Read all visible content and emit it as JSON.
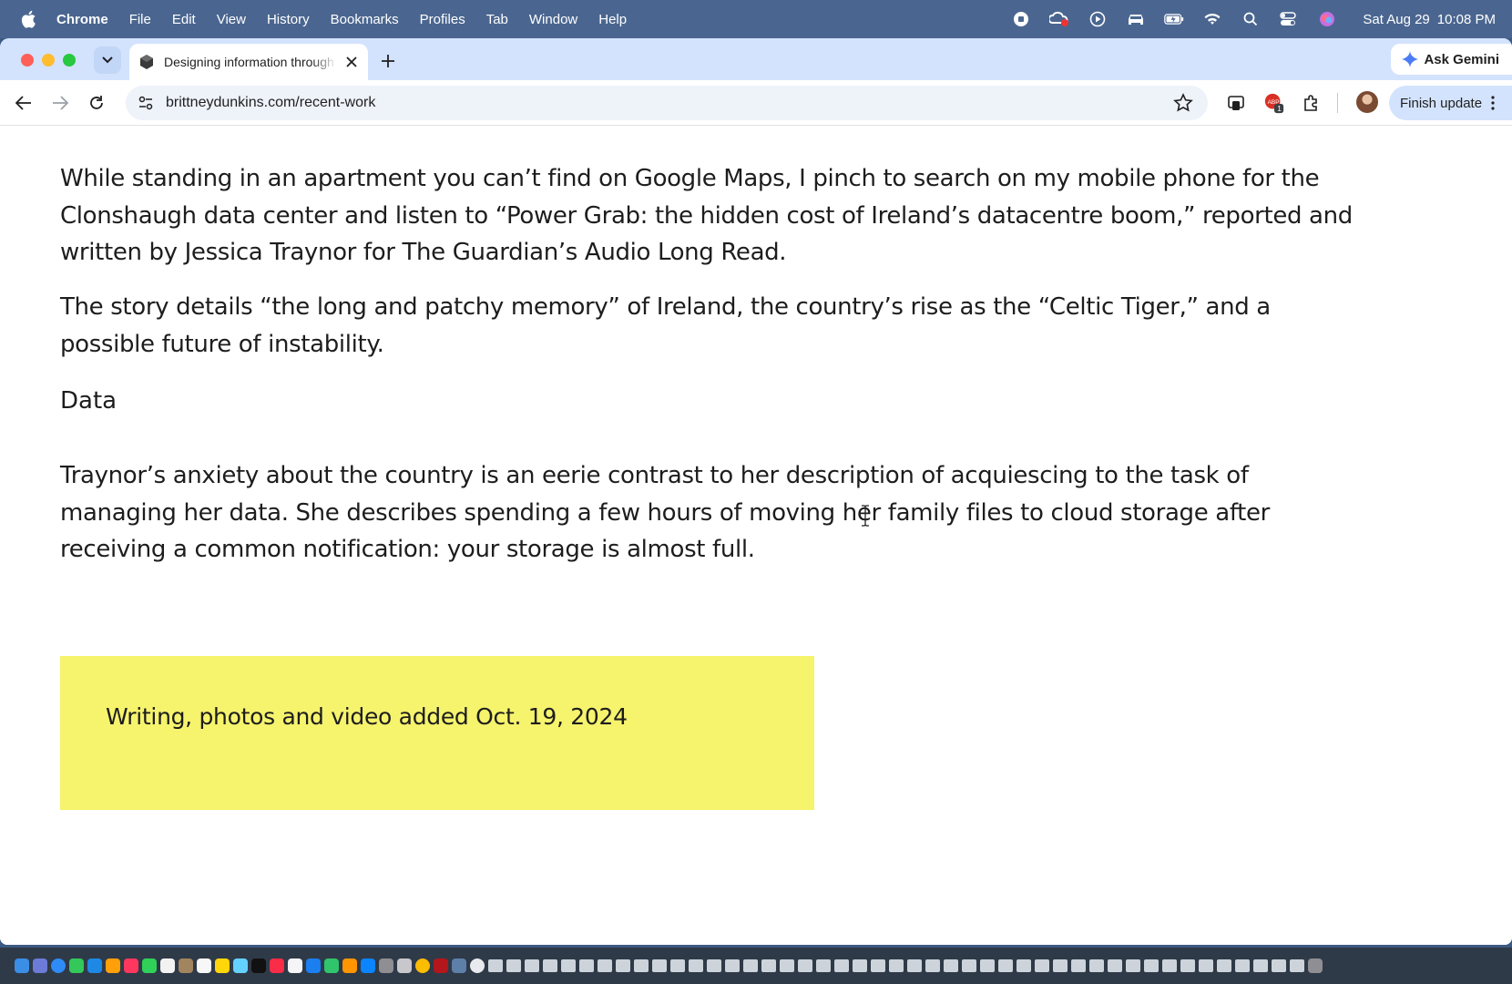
{
  "menubar": {
    "app_name": "Chrome",
    "menus": [
      "File",
      "Edit",
      "View",
      "History",
      "Bookmarks",
      "Profiles",
      "Tab",
      "Window",
      "Help"
    ],
    "status_icons": [
      "screen-record-icon",
      "creative-cloud-icon",
      "play-icon",
      "car-icon",
      "battery-icon",
      "wifi-icon",
      "spotlight-search-icon",
      "control-center-icon",
      "siri-icon"
    ],
    "date": "Sat Aug 29",
    "time": "10:08 PM"
  },
  "browser": {
    "tab_title": "Designing information through",
    "ask_gemini_label": "Ask Gemini",
    "url": "brittneydunkins.com/recent-work",
    "finish_update_label": "Finish update",
    "extension_badge": "1"
  },
  "article": {
    "paragraph_1": "While standing in an apartment you can’t find on Google Maps, I pinch to search on my mobile phone for the Clonshaugh data center and listen to “Power Grab: the hidden cost of Ireland’s datacentre boom,” reported and written by Jessica Traynor for The Guardian’s Audio Long Read.",
    "paragraph_2": " The story details “the long and patchy memory” of Ireland, the country’s rise as the “Celtic Tiger,” and a possible future of instability.",
    "heading": "Data",
    "paragraph_3": "Traynor’s anxiety about the country is an eerie contrast to her description of acquiescing to the task of managing her data. She describes spending a few hours of moving her family files to cloud storage after receiving a common notification: your storage is almost full.",
    "note": "Writing, photos and video added Oct. 19, 2024"
  },
  "colors": {
    "menubar_bg": "#4a6690",
    "tabstrip_bg": "#d3e3fd",
    "note_bg": "#f6f36d",
    "text": "#1d1d1d"
  }
}
